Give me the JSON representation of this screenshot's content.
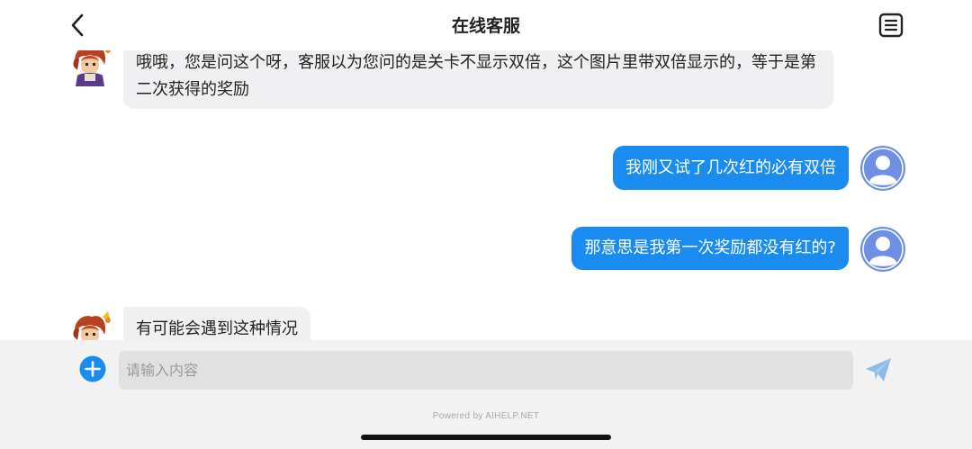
{
  "header": {
    "title": "在线客服",
    "back_icon": "chevron-left-icon",
    "menu_icon": "list-document-icon"
  },
  "messages": [
    {
      "sender": "agent",
      "text": "哦哦，您是问这个呀，客服以为您问的是关卡不显示双倍，这个图片里带双倍显示的，等于是第二次获得的奖励"
    },
    {
      "sender": "user",
      "text": "我刚又试了几次红的必有双倍"
    },
    {
      "sender": "user",
      "text": "那意思是我第一次奖励都没有红的?"
    },
    {
      "sender": "agent",
      "text": "有可能会遇到这种情况"
    }
  ],
  "input": {
    "placeholder": "请输入内容",
    "value": "",
    "add_icon": "plus-circle-icon",
    "send_icon": "paper-plane-icon"
  },
  "footer": {
    "powered_by": "Powered by AIHELP.NET"
  },
  "colors": {
    "accent": "#1a8cf0",
    "agent_bubble": "#f0f0f2",
    "user_avatar": "#6e8fe3",
    "input_bar": "#f2f2f2"
  }
}
